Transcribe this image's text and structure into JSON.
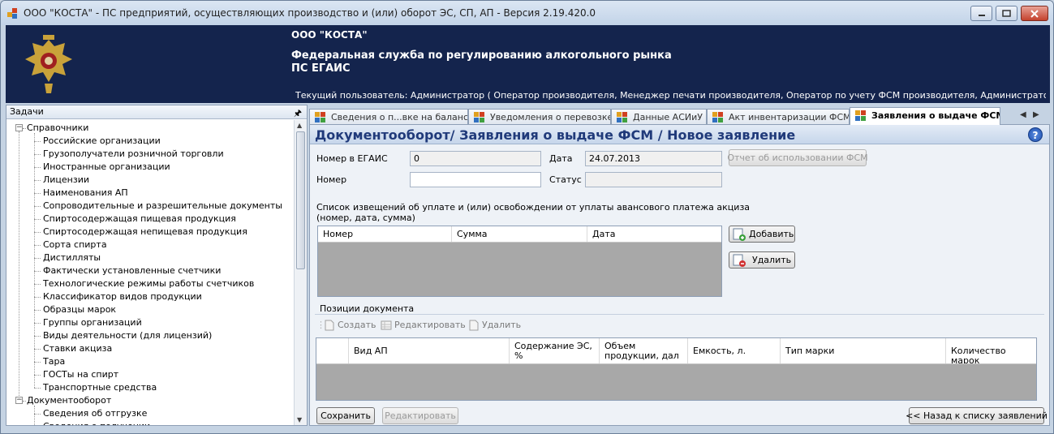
{
  "window": {
    "title": "ООО \"КОСТА\" - ПС предприятий, осуществляющих производство и (или) оборот ЭС, СП, АП - Версия 2.19.420.0"
  },
  "banner": {
    "org": "ООО \"КОСТА\"",
    "service_line1": "Федеральная служба по регулированию алкогольного рынка",
    "service_line2": "ПС ЕГАИС",
    "current_user": "Текущий пользователь: Администратор ( Оператор производителя, Менеджер печати производителя, Оператор по учету ФСМ производителя, Администратор производителя, Оп..."
  },
  "tasks_panel": {
    "title": "Задачи",
    "pin_glyph": "🖈",
    "tree": [
      {
        "label": "Справочники",
        "children": [
          "Российские организации",
          "Грузополучатели розничной торговли",
          "Иностранные организации",
          "Лицензии",
          "Наименования АП",
          "Сопроводительные и разрешительные документы",
          "Спиртосодержащая пищевая продукция",
          "Спиртосодержащая непищевая продукция",
          "Сорта спирта",
          "Дистилляты",
          "Фактически установленные счетчики",
          "Технологические режимы работы счетчиков",
          "Классификатор видов продукции",
          "Образцы марок",
          "Группы организаций",
          "Виды деятельности (для лицензий)",
          "Ставки акциза",
          "Тара",
          "ГОСТы на спирт",
          "Транспортные средства"
        ]
      },
      {
        "label": "Документооборот",
        "children": [
          "Сведения об отгрузке",
          "Сведения о получении"
        ]
      }
    ]
  },
  "tabs": [
    {
      "label": "Сведения о п...вке на баланс",
      "active": false
    },
    {
      "label": "Уведомления о перевозке",
      "active": false
    },
    {
      "label": "Данные АСИиУ",
      "active": false
    },
    {
      "label": "Акт инвентаризации ФСМ",
      "active": false
    },
    {
      "label": "Заявления о выдаче ФСМ",
      "active": true
    }
  ],
  "form": {
    "doc_title": "Документооборот/ Заявления о выдаче ФСМ / Новое заявление",
    "help": "?",
    "egais_number_label": "Номер в ЕГАИС",
    "egais_number_value": "0",
    "date_label": "Дата",
    "date_value": "24.07.2013",
    "fsm_report_button": "Отчет об использовании ФСМ",
    "number_label": "Номер",
    "number_value": "",
    "status_label": "Статус",
    "status_value": "",
    "notices_caption_line1": "Список извещений об уплате и (или) освобождении от уплаты авансового платежа акциза",
    "notices_caption_line2": "(номер, дата, сумма)",
    "notices_columns": [
      "Номер",
      "Сумма",
      "Дата"
    ],
    "add_button": "Добавить",
    "delete_button": "Удалить",
    "positions_caption": "Позиции документа",
    "toolbar": {
      "create": "Создать",
      "edit": "Редактировать",
      "delete": "Удалить"
    },
    "positions_columns": [
      "Вид АП",
      "Содержание ЭС, %",
      "Объем продукции, дал",
      "Емкость, л.",
      "Тип марки",
      "Количество марок"
    ],
    "save_button": "Сохранить",
    "edit_button": "Редактировать",
    "back_button": "<< Назад к списку заявлений"
  },
  "colors": {
    "banner_bg": "#14244d",
    "title_text": "#203a7a"
  }
}
